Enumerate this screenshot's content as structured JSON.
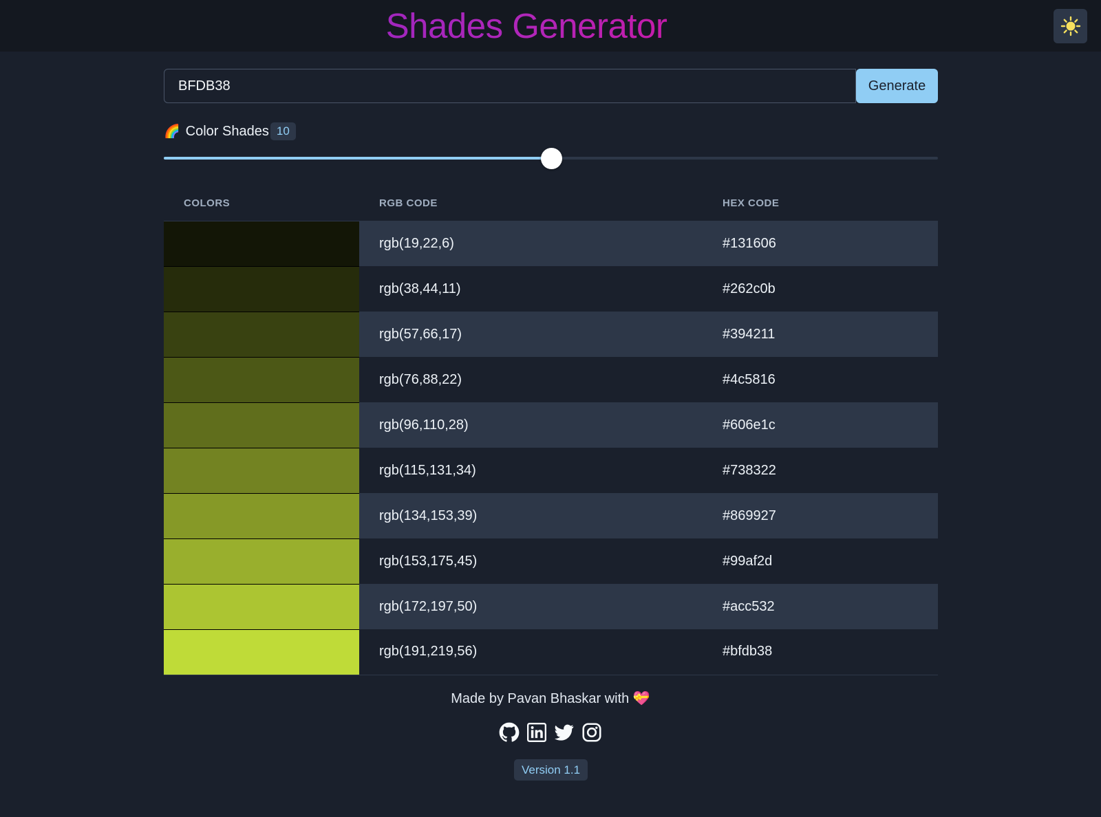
{
  "header": {
    "title": "Shades Generator",
    "theme_toggle_icon": "sun-icon"
  },
  "input": {
    "value": "BFDB38",
    "generate_label": "Generate"
  },
  "shades": {
    "label": "Color Shades",
    "icon": "rainbow-icon",
    "count": "10",
    "slider_fraction": 0.5
  },
  "table": {
    "headers": [
      "COLORS",
      "RGB CODE",
      "HEX CODE"
    ],
    "rows": [
      {
        "rgb": "rgb(19,22,6)",
        "hex": "#131606"
      },
      {
        "rgb": "rgb(38,44,11)",
        "hex": "#262c0b"
      },
      {
        "rgb": "rgb(57,66,17)",
        "hex": "#394211"
      },
      {
        "rgb": "rgb(76,88,22)",
        "hex": "#4c5816"
      },
      {
        "rgb": "rgb(96,110,28)",
        "hex": "#606e1c"
      },
      {
        "rgb": "rgb(115,131,34)",
        "hex": "#738322"
      },
      {
        "rgb": "rgb(134,153,39)",
        "hex": "#869927"
      },
      {
        "rgb": "rgb(153,175,45)",
        "hex": "#99af2d"
      },
      {
        "rgb": "rgb(172,197,50)",
        "hex": "#acc532"
      },
      {
        "rgb": "rgb(191,219,56)",
        "hex": "#bfdb38"
      }
    ]
  },
  "footer": {
    "made_by": "Made by Pavan Bhaskar with",
    "heart_icon": "heart-icon",
    "socials": [
      "github-icon",
      "linkedin-icon",
      "twitter-icon",
      "instagram-icon"
    ],
    "version": "Version 1.1"
  }
}
